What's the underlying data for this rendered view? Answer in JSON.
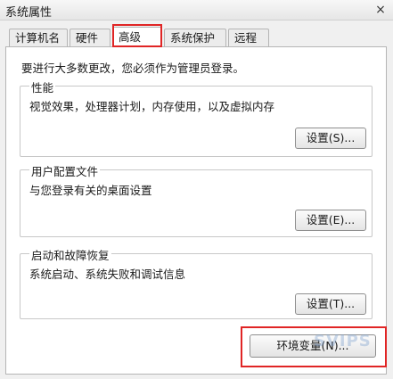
{
  "window": {
    "title": "系统属性",
    "close_glyph": "×"
  },
  "tabs": [
    {
      "label": "计算机名",
      "active": false
    },
    {
      "label": "硬件",
      "active": false
    },
    {
      "label": "高级",
      "active": true
    },
    {
      "label": "系统保护",
      "active": false
    },
    {
      "label": "远程",
      "active": false
    }
  ],
  "advanced": {
    "notice": "要进行大多数更改，您必须作为管理员登录。",
    "performance": {
      "title": "性能",
      "description": "视觉效果，处理器计划，内存使用，以及虚拟内存",
      "button_label": "设置(S)..."
    },
    "user_profiles": {
      "title": "用户配置文件",
      "description": "与您登录有关的桌面设置",
      "button_label": "设置(E)..."
    },
    "startup_recovery": {
      "title": "启动和故障恢复",
      "description": "系统启动、系统失败和调试信息",
      "button_label": "设置(T)..."
    },
    "env_button_label": "环境变量(N)..."
  },
  "watermark": "SVIPS",
  "colors": {
    "highlight": "#e02525",
    "page_bg": "#ffffff",
    "window_bg": "#f0f0f0"
  }
}
